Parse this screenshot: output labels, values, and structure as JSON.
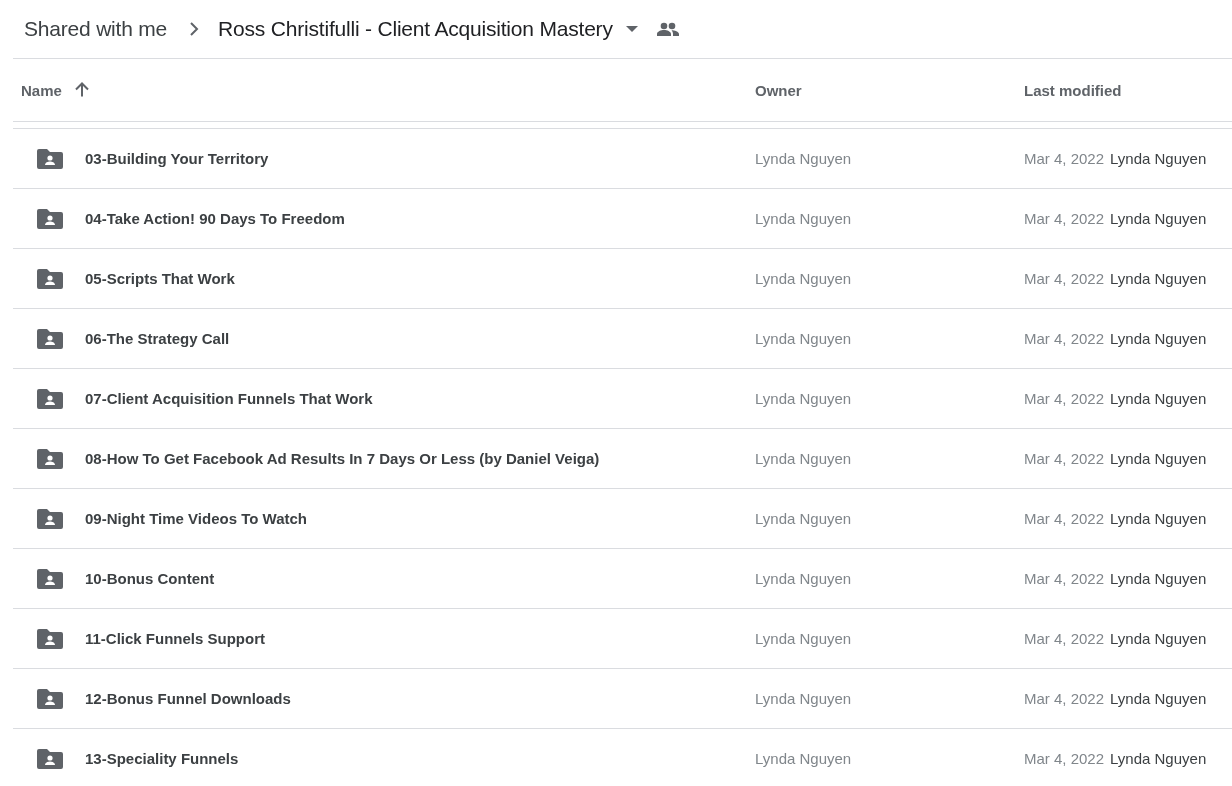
{
  "breadcrumb": {
    "parent": "Shared with me",
    "current": "Ross Christifulli - Client Acquisition Mastery"
  },
  "columns": [
    {
      "label": "Name",
      "sorted": true
    },
    {
      "label": "Owner",
      "sorted": false
    },
    {
      "label": "Last modified",
      "sorted": false
    }
  ],
  "rows": [
    {
      "name": "03-Building Your Territory",
      "owner": "Lynda Nguyen",
      "modified": "Mar 4, 2022",
      "modified_by": "Lynda Nguyen"
    },
    {
      "name": "04-Take Action! 90 Days To Freedom",
      "owner": "Lynda Nguyen",
      "modified": "Mar 4, 2022",
      "modified_by": "Lynda Nguyen"
    },
    {
      "name": "05-Scripts That Work",
      "owner": "Lynda Nguyen",
      "modified": "Mar 4, 2022",
      "modified_by": "Lynda Nguyen"
    },
    {
      "name": "06-The Strategy Call",
      "owner": "Lynda Nguyen",
      "modified": "Mar 4, 2022",
      "modified_by": "Lynda Nguyen"
    },
    {
      "name": "07-Client Acquisition Funnels That Work",
      "owner": "Lynda Nguyen",
      "modified": "Mar 4, 2022",
      "modified_by": "Lynda Nguyen"
    },
    {
      "name": "08-How To Get Facebook Ad Results In 7 Days Or Less (by Daniel Veiga)",
      "owner": "Lynda Nguyen",
      "modified": "Mar 4, 2022",
      "modified_by": "Lynda Nguyen"
    },
    {
      "name": "09-Night Time Videos To Watch",
      "owner": "Lynda Nguyen",
      "modified": "Mar 4, 2022",
      "modified_by": "Lynda Nguyen"
    },
    {
      "name": "10-Bonus Content",
      "owner": "Lynda Nguyen",
      "modified": "Mar 4, 2022",
      "modified_by": "Lynda Nguyen"
    },
    {
      "name": "11-Click Funnels Support",
      "owner": "Lynda Nguyen",
      "modified": "Mar 4, 2022",
      "modified_by": "Lynda Nguyen"
    },
    {
      "name": "12-Bonus Funnel Downloads",
      "owner": "Lynda Nguyen",
      "modified": "Mar 4, 2022",
      "modified_by": "Lynda Nguyen"
    },
    {
      "name": "13-Speciality Funnels",
      "owner": "Lynda Nguyen",
      "modified": "Mar 4, 2022",
      "modified_by": "Lynda Nguyen"
    }
  ]
}
